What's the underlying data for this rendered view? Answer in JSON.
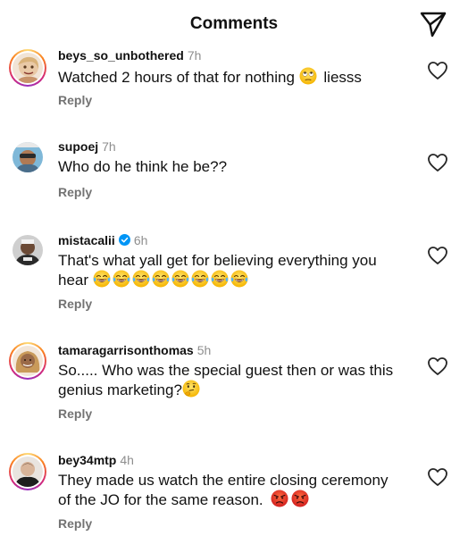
{
  "header": {
    "title": "Comments",
    "share_icon": "paper-plane-icon"
  },
  "comments": [
    {
      "username": "beys_so_unbothered",
      "time": "7h",
      "text_line1": "Watched 2 hours of that for nothing",
      "text_tail": "liesss",
      "emojis": [
        "face-with-rolling-eyes"
      ],
      "reply_label": "Reply",
      "has_story_ring": true
    },
    {
      "username": "supoej",
      "time": "7h",
      "text_line1": "Who do he think he be??",
      "reply_label": "Reply",
      "has_story_ring": false
    },
    {
      "username": "mistacalii",
      "time": "6h",
      "verified": true,
      "text_line1": "That's what yall get for believing everything you",
      "text_line2": "hear",
      "emojis": [
        "face-with-tears-of-joy",
        "face-with-tears-of-joy",
        "face-with-tears-of-joy",
        "face-with-tears-of-joy",
        "face-with-tears-of-joy",
        "face-with-tears-of-joy",
        "face-with-tears-of-joy",
        "face-with-tears-of-joy"
      ],
      "reply_label": "Reply",
      "has_story_ring": false
    },
    {
      "username": "tamaragarrisonthomas",
      "time": "5h",
      "text_line1": "So..... Who was the special guest then or was this",
      "text_line2": "genius marketing?",
      "emojis": [
        "thinking-face"
      ],
      "reply_label": "Reply",
      "has_story_ring": true
    },
    {
      "username": "bey34mtp",
      "time": "4h",
      "text_line1": "They made us watch the entire closing ceremony",
      "text_line2": "of the JO for the same reason.",
      "emojis": [
        "pouting-face",
        "pouting-face"
      ],
      "reply_label": "Reply",
      "has_story_ring": true
    }
  ],
  "colors": {
    "text": "#111111",
    "muted": "#8e8e8e",
    "reply": "#737373",
    "verified_blue": "#0095f6",
    "story_ring": [
      "#feda75",
      "#fa7e1e",
      "#d62976",
      "#962fbf"
    ]
  }
}
